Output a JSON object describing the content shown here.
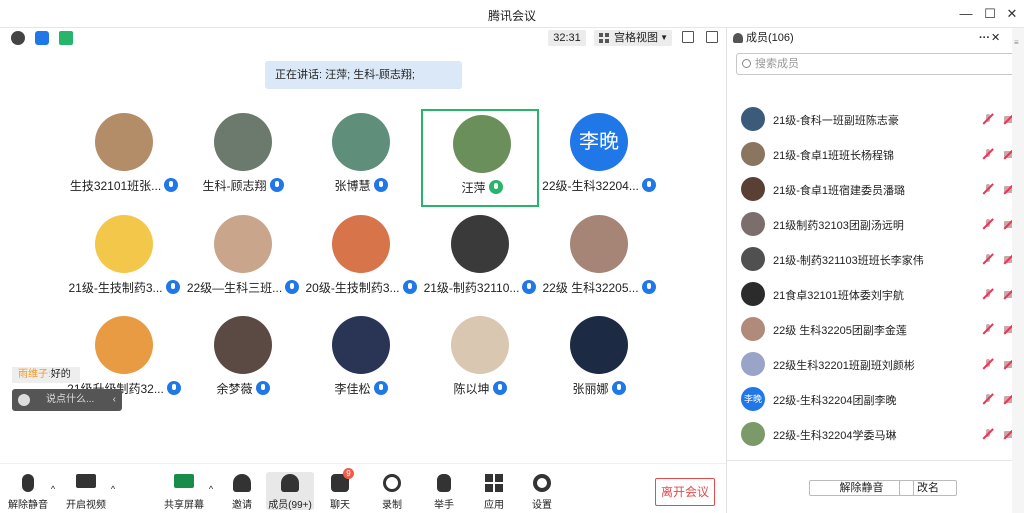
{
  "window": {
    "title": "腾讯会议"
  },
  "toolbar": {
    "timer": "32:31",
    "view_mode": "宫格视图"
  },
  "speaking": {
    "text": "正在讲话: 汪萍; 生科-顾志翔;"
  },
  "participants": [
    {
      "name": "生技32101班张...",
      "av": "#b38d67"
    },
    {
      "name": "生科-顾志翔",
      "av": "#6c7a6e"
    },
    {
      "name": "张博慧",
      "av": "#5f8e7a"
    },
    {
      "name": "汪萍",
      "av": "#6b8f5a"
    },
    {
      "name": "22级-生科32204...",
      "av": "#1f77e8",
      "text": "李晚"
    },
    {
      "name": "21级-生技制药3...",
      "av": "#f2c74a"
    },
    {
      "name": "22级—生科三班...",
      "av": "#c9a58b"
    },
    {
      "name": "20级-生技制药3...",
      "av": "#d8744a"
    },
    {
      "name": "21级-制药32110...",
      "av": "#3a3a3a"
    },
    {
      "name": "22级 生科32205...",
      "av": "#a68476"
    },
    {
      "name": "21级升级制药32...",
      "av": "#e89b42"
    },
    {
      "name": "余梦薇",
      "av": "#5b4a44"
    },
    {
      "name": "李佳松",
      "av": "#2a3454"
    },
    {
      "name": "陈以坤",
      "av": "#d9c7b1"
    },
    {
      "name": "张丽娜",
      "av": "#1d2a44"
    }
  ],
  "chat": {
    "bubble_name": "雨维子:",
    "bubble_text": "好的",
    "placeholder": "说点什么..."
  },
  "bottom": {
    "mute": "解除静音",
    "video": "开启视频",
    "share": "共享屏幕",
    "invite": "邀请",
    "members": "成员(99+)",
    "chat": "聊天",
    "chat_badge": "9",
    "record": "录制",
    "hand": "举手",
    "apps": "应用",
    "settings": "设置",
    "leave": "离开会议"
  },
  "panel": {
    "title": "成员(106)",
    "search_placeholder": "搜索成员",
    "members": [
      {
        "name": "21级-食科一班副班陈志豪",
        "av": "#3c5b7a"
      },
      {
        "name": "21级-食卓1班班长杨程锦",
        "av": "#8a7560"
      },
      {
        "name": "21级-食卓1班宿建委员潘璐",
        "av": "#5a4034"
      },
      {
        "name": "21级制药32103团副汤远明",
        "av": "#7c6e6c"
      },
      {
        "name": "21级-制药321103班班长李家伟",
        "av": "#505050"
      },
      {
        "name": "21食卓32101班体委刘宇航",
        "av": "#2b2b2b"
      },
      {
        "name": "22级 生科32205团副李金莲",
        "av": "#b08a7a"
      },
      {
        "name": "22级生科32201班副班刘颜彬",
        "av": "#9aa4c8"
      },
      {
        "name": "22级-生科32204团副李晚",
        "av": "#1f77e8",
        "text": "李晚"
      },
      {
        "name": "22级-生科32204学委马琳",
        "av": "#7a9a6a"
      }
    ],
    "unmute_all": "解除静音",
    "rename": "改名"
  },
  "colors": {
    "accent": "#1f77e8",
    "active_border": "#26b56b",
    "danger": "#e84a4a"
  }
}
